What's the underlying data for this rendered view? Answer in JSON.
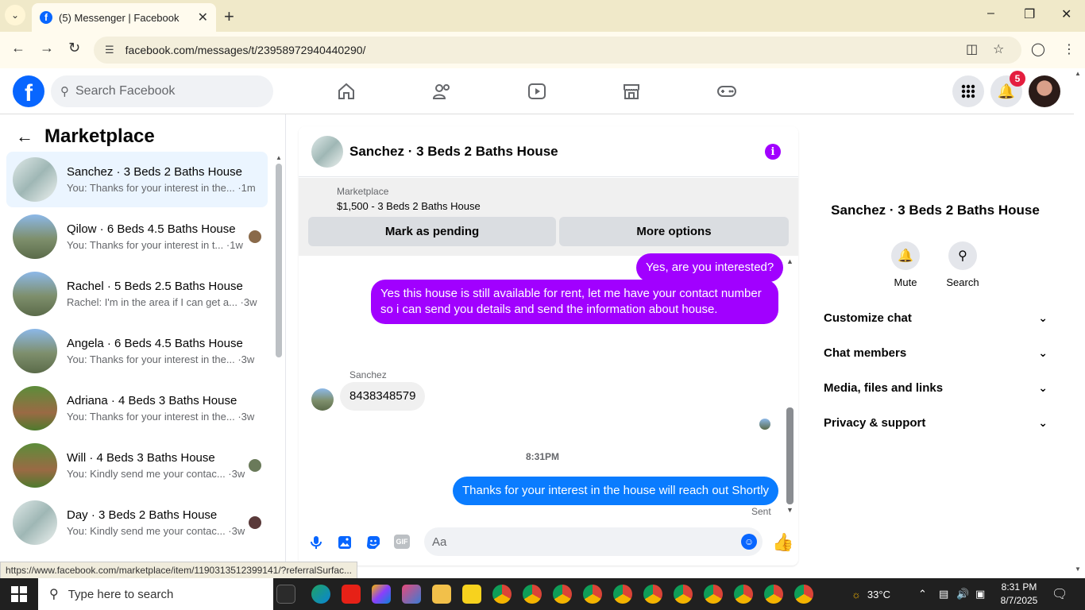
{
  "browser": {
    "tab_title": "(5) Messenger | Facebook",
    "url": "facebook.com/messages/t/23958972940440290/",
    "status_url": "https://www.facebook.com/marketplace/item/1190313512399141/?referralSurfac..."
  },
  "header": {
    "search_placeholder": "Search Facebook",
    "notification_count": "5"
  },
  "sidebar": {
    "title": "Marketplace",
    "conversations": [
      {
        "name": "Sanchez · 3 Beds 2 Baths House",
        "preview": "You: Thanks for your interest in the... ·1m"
      },
      {
        "name": "Qilow · 6 Beds 4.5 Baths House",
        "preview": "You: Thanks for your interest in t... ·1w"
      },
      {
        "name": "Rachel · 5 Beds 2.5 Baths House",
        "preview": "Rachel: I'm in the area if I can get a... ·3w"
      },
      {
        "name": "Angela · 6 Beds 4.5 Baths House",
        "preview": "You: Thanks for your interest in the... ·3w"
      },
      {
        "name": "Adriana · 4 Beds 3 Baths House",
        "preview": "You: Thanks for your interest in the... ·3w"
      },
      {
        "name": "Will · 4 Beds 3 Baths House",
        "preview": "You: Kindly send me your contac... ·3w"
      },
      {
        "name": "Day · 3 Beds 2 Baths House",
        "preview": "You: Kindly send me your contac... ·3w"
      }
    ]
  },
  "chat": {
    "title": "Sanchez · 3 Beds 2 Baths House",
    "marketplace_label": "Marketplace",
    "listing": "$1,500 - 3 Beds 2 Baths House",
    "mark_pending_label": "Mark as pending",
    "more_options_label": "More options",
    "messages": {
      "m1": "Yes, are you interested?",
      "m2": "Yes this house is still available for rent, let me have your contact number so i can send you details and send the information about house.",
      "sender": "Sanchez",
      "m3": "8438348579",
      "time": "8:31PM",
      "m4": "Thanks for your interest in the house will reach out Shortly",
      "status": "Sent"
    },
    "composer_placeholder": "Aa"
  },
  "details": {
    "name": "Sanchez · 3 Beds 2 Baths House",
    "mute_label": "Mute",
    "search_label": "Search",
    "sections": [
      "Customize chat",
      "Chat members",
      "Media, files and links",
      "Privacy & support"
    ]
  },
  "taskbar": {
    "search_placeholder": "Type here to search",
    "temperature": "33°C",
    "time": "8:31 PM",
    "date": "8/7/2025"
  }
}
